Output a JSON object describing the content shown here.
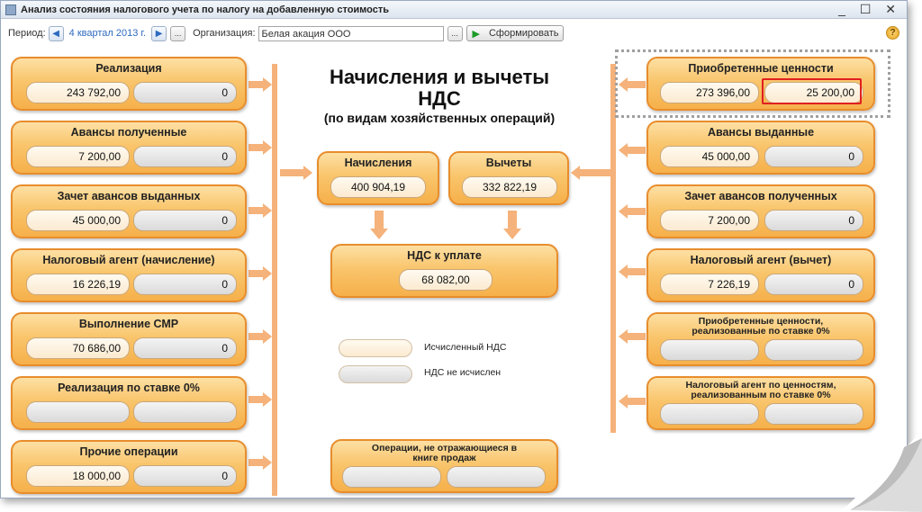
{
  "window": {
    "title": "Анализ состояния налогового учета по налогу на добавленную стоимость",
    "controls": {
      "minimize": "_",
      "maximize": "☐",
      "close": "✕"
    }
  },
  "toolbar": {
    "period_label": "Период:",
    "period_value": "4 квартал 2013 г.",
    "dots_label": "...",
    "organization_label": "Организация:",
    "organization_value": "Белая акация ООО",
    "run_label": "Сформировать",
    "help_label": "?"
  },
  "headline": {
    "line1": "Начисления и вычеты",
    "line1b": "НДС",
    "line2": "(по видам хозяйственных операций)"
  },
  "left_panels": [
    {
      "title": "Реализация",
      "base": "243 792,00",
      "vat": "0"
    },
    {
      "title": "Авансы полученные",
      "base": "7 200,00",
      "vat": "0"
    },
    {
      "title": "Зачет авансов выданных",
      "base": "45 000,00",
      "vat": "0"
    },
    {
      "title": "Налоговый агент (начисление)",
      "base": "16 226,19",
      "vat": "0"
    },
    {
      "title": "Выполнение СМР",
      "base": "70 686,00",
      "vat": "0"
    },
    {
      "title": "Реализация по ставке 0%",
      "base": "",
      "vat": ""
    },
    {
      "title": "Прочие операции",
      "base": "18 000,00",
      "vat": "0"
    }
  ],
  "right_panels": [
    {
      "title": "Приобретенные ценности",
      "base": "273 396,00",
      "vat": "25 200,00"
    },
    {
      "title": "Авансы выданные",
      "base": "45 000,00",
      "vat": "0"
    },
    {
      "title": "Зачет авансов полученных",
      "base": "7 200,00",
      "vat": "0"
    },
    {
      "title": "Налоговый агент (вычет)",
      "base": "7 226,19",
      "vat": "0"
    },
    {
      "title": "Приобретенные ценности, реализованные по ставке 0%",
      "base": "",
      "vat": ""
    },
    {
      "title": "Налоговый агент по ценностям, реализованным по ставке 0%",
      "base": "",
      "vat": ""
    }
  ],
  "center": {
    "accruals": {
      "title": "Начисления",
      "value": "400 904,19"
    },
    "deductions": {
      "title": "Вычеты",
      "value": "332 822,19"
    },
    "payable": {
      "title": "НДС к уплате",
      "value": "68 082,00"
    },
    "not_in_sales_book": {
      "title": "Операции, не отражающиеся в книге продаж",
      "base": "",
      "vat": ""
    }
  },
  "legend": {
    "computed": "Исчисленный НДС",
    "not_computed": "НДС не исчислен"
  },
  "colors": {
    "panel_border": "#e88d2c",
    "panel_fill": "#f9c56c",
    "arrow": "#f5b27a",
    "highlight": "#e02020",
    "link": "#2e6abf"
  }
}
